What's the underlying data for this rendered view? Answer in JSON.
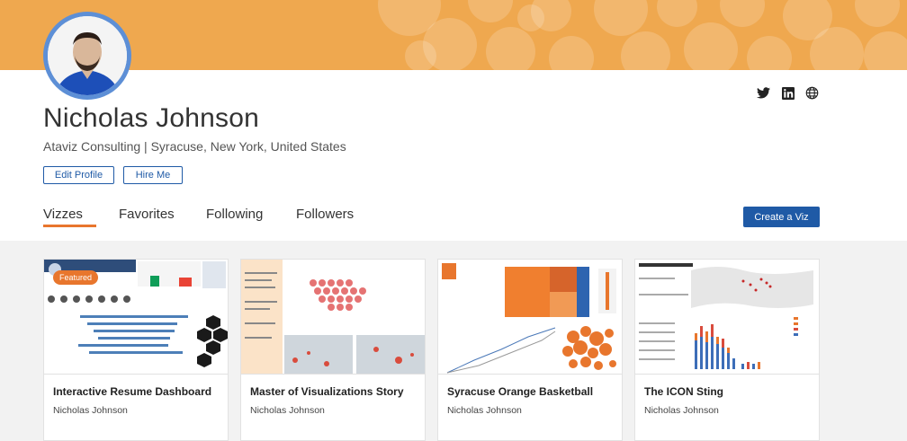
{
  "profile": {
    "name": "Nicholas Johnson",
    "subtitle": "Ataviz Consulting | Syracuse, New York, United States",
    "edit_profile_label": "Edit Profile",
    "hire_me_label": "Hire Me"
  },
  "socials": [
    "twitter-icon",
    "linkedin-icon",
    "globe-icon"
  ],
  "tabs": [
    {
      "label": "Vizzes",
      "active": true
    },
    {
      "label": "Favorites",
      "active": false
    },
    {
      "label": "Following",
      "active": false
    },
    {
      "label": "Followers",
      "active": false
    }
  ],
  "create_viz_label": "Create a Viz",
  "featured_label": "Featured",
  "colors": {
    "banner": "#efa84f",
    "accent": "#e8762d",
    "primary": "#1f5aa6",
    "gallery_bg": "#f2f2f2"
  },
  "vizzes": [
    {
      "title": "Interactive Resume Dashboard",
      "author": "Nicholas Johnson",
      "featured": true
    },
    {
      "title": "Master of Visualizations Story",
      "author": "Nicholas Johnson",
      "featured": false
    },
    {
      "title": "Syracuse Orange Basketball",
      "author": "Nicholas Johnson",
      "featured": false
    },
    {
      "title": "The ICON Sting",
      "author": "Nicholas Johnson",
      "featured": false
    }
  ]
}
